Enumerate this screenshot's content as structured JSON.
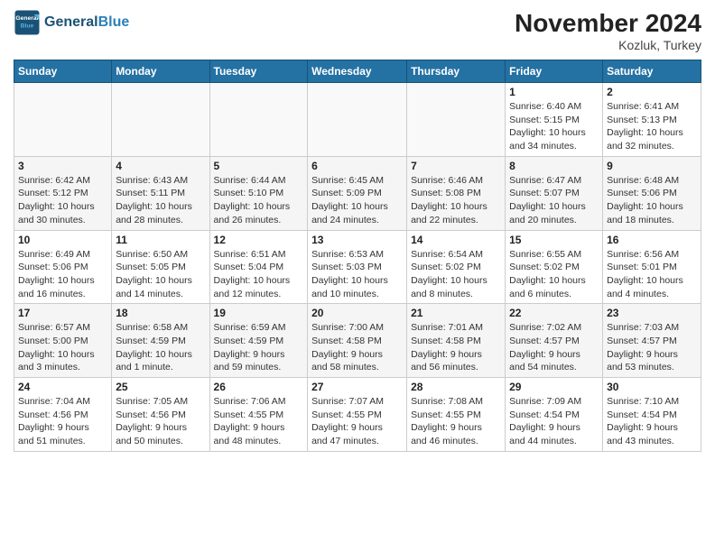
{
  "header": {
    "logo_line1": "General",
    "logo_line2": "Blue",
    "month_title": "November 2024",
    "location": "Kozluk, Turkey"
  },
  "weekdays": [
    "Sunday",
    "Monday",
    "Tuesday",
    "Wednesday",
    "Thursday",
    "Friday",
    "Saturday"
  ],
  "weeks": [
    [
      {
        "day": "",
        "info": ""
      },
      {
        "day": "",
        "info": ""
      },
      {
        "day": "",
        "info": ""
      },
      {
        "day": "",
        "info": ""
      },
      {
        "day": "",
        "info": ""
      },
      {
        "day": "1",
        "info": "Sunrise: 6:40 AM\nSunset: 5:15 PM\nDaylight: 10 hours\nand 34 minutes."
      },
      {
        "day": "2",
        "info": "Sunrise: 6:41 AM\nSunset: 5:13 PM\nDaylight: 10 hours\nand 32 minutes."
      }
    ],
    [
      {
        "day": "3",
        "info": "Sunrise: 6:42 AM\nSunset: 5:12 PM\nDaylight: 10 hours\nand 30 minutes."
      },
      {
        "day": "4",
        "info": "Sunrise: 6:43 AM\nSunset: 5:11 PM\nDaylight: 10 hours\nand 28 minutes."
      },
      {
        "day": "5",
        "info": "Sunrise: 6:44 AM\nSunset: 5:10 PM\nDaylight: 10 hours\nand 26 minutes."
      },
      {
        "day": "6",
        "info": "Sunrise: 6:45 AM\nSunset: 5:09 PM\nDaylight: 10 hours\nand 24 minutes."
      },
      {
        "day": "7",
        "info": "Sunrise: 6:46 AM\nSunset: 5:08 PM\nDaylight: 10 hours\nand 22 minutes."
      },
      {
        "day": "8",
        "info": "Sunrise: 6:47 AM\nSunset: 5:07 PM\nDaylight: 10 hours\nand 20 minutes."
      },
      {
        "day": "9",
        "info": "Sunrise: 6:48 AM\nSunset: 5:06 PM\nDaylight: 10 hours\nand 18 minutes."
      }
    ],
    [
      {
        "day": "10",
        "info": "Sunrise: 6:49 AM\nSunset: 5:06 PM\nDaylight: 10 hours\nand 16 minutes."
      },
      {
        "day": "11",
        "info": "Sunrise: 6:50 AM\nSunset: 5:05 PM\nDaylight: 10 hours\nand 14 minutes."
      },
      {
        "day": "12",
        "info": "Sunrise: 6:51 AM\nSunset: 5:04 PM\nDaylight: 10 hours\nand 12 minutes."
      },
      {
        "day": "13",
        "info": "Sunrise: 6:53 AM\nSunset: 5:03 PM\nDaylight: 10 hours\nand 10 minutes."
      },
      {
        "day": "14",
        "info": "Sunrise: 6:54 AM\nSunset: 5:02 PM\nDaylight: 10 hours\nand 8 minutes."
      },
      {
        "day": "15",
        "info": "Sunrise: 6:55 AM\nSunset: 5:02 PM\nDaylight: 10 hours\nand 6 minutes."
      },
      {
        "day": "16",
        "info": "Sunrise: 6:56 AM\nSunset: 5:01 PM\nDaylight: 10 hours\nand 4 minutes."
      }
    ],
    [
      {
        "day": "17",
        "info": "Sunrise: 6:57 AM\nSunset: 5:00 PM\nDaylight: 10 hours\nand 3 minutes."
      },
      {
        "day": "18",
        "info": "Sunrise: 6:58 AM\nSunset: 4:59 PM\nDaylight: 10 hours\nand 1 minute."
      },
      {
        "day": "19",
        "info": "Sunrise: 6:59 AM\nSunset: 4:59 PM\nDaylight: 9 hours\nand 59 minutes."
      },
      {
        "day": "20",
        "info": "Sunrise: 7:00 AM\nSunset: 4:58 PM\nDaylight: 9 hours\nand 58 minutes."
      },
      {
        "day": "21",
        "info": "Sunrise: 7:01 AM\nSunset: 4:58 PM\nDaylight: 9 hours\nand 56 minutes."
      },
      {
        "day": "22",
        "info": "Sunrise: 7:02 AM\nSunset: 4:57 PM\nDaylight: 9 hours\nand 54 minutes."
      },
      {
        "day": "23",
        "info": "Sunrise: 7:03 AM\nSunset: 4:57 PM\nDaylight: 9 hours\nand 53 minutes."
      }
    ],
    [
      {
        "day": "24",
        "info": "Sunrise: 7:04 AM\nSunset: 4:56 PM\nDaylight: 9 hours\nand 51 minutes."
      },
      {
        "day": "25",
        "info": "Sunrise: 7:05 AM\nSunset: 4:56 PM\nDaylight: 9 hours\nand 50 minutes."
      },
      {
        "day": "26",
        "info": "Sunrise: 7:06 AM\nSunset: 4:55 PM\nDaylight: 9 hours\nand 48 minutes."
      },
      {
        "day": "27",
        "info": "Sunrise: 7:07 AM\nSunset: 4:55 PM\nDaylight: 9 hours\nand 47 minutes."
      },
      {
        "day": "28",
        "info": "Sunrise: 7:08 AM\nSunset: 4:55 PM\nDaylight: 9 hours\nand 46 minutes."
      },
      {
        "day": "29",
        "info": "Sunrise: 7:09 AM\nSunset: 4:54 PM\nDaylight: 9 hours\nand 44 minutes."
      },
      {
        "day": "30",
        "info": "Sunrise: 7:10 AM\nSunset: 4:54 PM\nDaylight: 9 hours\nand 43 minutes."
      }
    ]
  ]
}
